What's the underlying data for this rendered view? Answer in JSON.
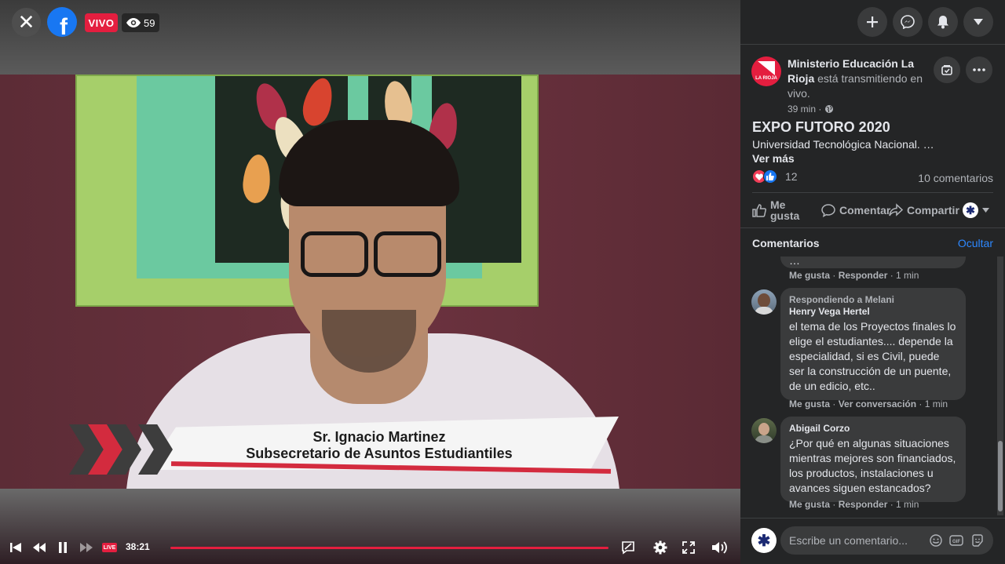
{
  "video": {
    "close_icon": "close-icon",
    "logo_icon": "facebook-logo-icon",
    "live_label": "VIVO",
    "viewer_count": "59",
    "lower_third_name": "Sr. Ignacio Martinez",
    "lower_third_title": "Subsecretario de Asuntos Estudiantiles",
    "controls": {
      "live_label": "LIVE",
      "elapsed": "38:21",
      "progress": 1.0
    }
  },
  "topbar": {
    "buttons": [
      "plus-icon",
      "messenger-icon",
      "notifications-icon",
      "account-menu-icon"
    ]
  },
  "post": {
    "page_name": "Ministerio Educación La Rioja",
    "action_text": " está transmitiendo en vivo.",
    "avatar_text": "LA RIOJA",
    "time": "39 min ·",
    "title": "EXPO FUTORO 2020",
    "description": "Universidad Tecnológica Nacional. …",
    "see_more": "Ver más",
    "reaction_count": "12",
    "comment_count": "10 comentarios",
    "actions": {
      "like": "Me gusta",
      "comment": "Comentar",
      "share": "Compartir"
    }
  },
  "comments": {
    "header": "Comentarios",
    "hide": "Ocultar",
    "items": [
      {
        "partial_text": "…",
        "meta_like": "Me gusta",
        "meta_reply": "Responder",
        "meta_time": "1 min"
      },
      {
        "replying_to": "Respondiendo a Melani",
        "author": "Henry Vega Hertel",
        "text": "el tema de los Proyectos finales lo elige el estudiantes.... depende la especialidad, si es Civil, puede ser la construcción de un puente, de un edicio, etc..",
        "meta_like": "Me gusta",
        "meta_reply": "Ver conversación",
        "meta_time": "1 min"
      },
      {
        "author": "Abigail Corzo",
        "text": "¿Por qué en algunas situaciones mientras mejores son financiados, los productos, instalaciones u avances siguen estancados?",
        "meta_like": "Me gusta",
        "meta_reply": "Responder",
        "meta_time": "1 min"
      }
    ]
  },
  "composer": {
    "placeholder": "Escribe un comentario..."
  },
  "colors": {
    "live_red": "#e41e3f",
    "accent_blue": "#2d88ff",
    "sidebar_bg": "#242526"
  }
}
